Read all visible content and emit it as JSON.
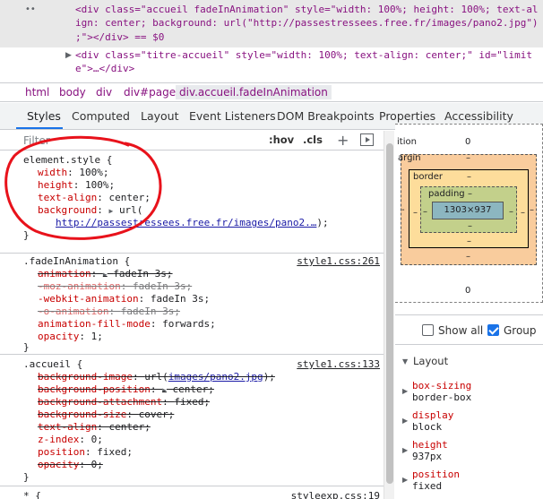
{
  "dom": {
    "dots": "••",
    "line1_a": "<div class=\"accueil fadeInAnimation\" style=\"width: 100%; height: 100%; text-al",
    "line1_b": "ign: center; background: url(\"http://passestressees.free.fr/images/pano2.jpg\")",
    "line1_c": ";\"></div> == $0",
    "line2_a": "<div class=\"titre-accueil\" style=\"width: 100%; text-align: center;\" id=\"limit",
    "line2_b": "e\">…</div>"
  },
  "breadcrumb": [
    "html",
    "body",
    "div",
    "div#page",
    "div.accueil.fadeInAnimation"
  ],
  "tabs": [
    "Styles",
    "Computed",
    "Layout",
    "Event Listeners",
    "DOM Breakpoints",
    "Properties",
    "Accessibility"
  ],
  "filter": {
    "placeholder": "Filter",
    "hov": ":hov",
    "cls": ".cls",
    "plus": "+"
  },
  "rules": {
    "element": {
      "selector": "element.style {",
      "props": [
        {
          "name": "width",
          "value": "100%;"
        },
        {
          "name": "height",
          "value": "100%;"
        },
        {
          "name": "text-align",
          "value": "center;"
        },
        {
          "name": "background",
          "value": "url("
        }
      ],
      "bg_url": "http://passestressees.free.fr/images/pano2.…",
      "bg_close": ");",
      "close": "}"
    },
    "fade": {
      "selector": ".fadeInAnimation {",
      "source": "style1.css:261",
      "props": [
        {
          "name": "animation",
          "value": "fadeIn 3s;"
        },
        {
          "name": "-moz-animation",
          "value": "fadeIn 3s;"
        },
        {
          "name": "-webkit-animation",
          "value": "fadeIn 3s;"
        },
        {
          "name": "-o-animation",
          "value": "fadeIn 3s;"
        },
        {
          "name": "animation-fill-mode",
          "value": "forwards;"
        },
        {
          "name": "opacity",
          "value": "1;"
        }
      ],
      "close": "}"
    },
    "accueil": {
      "selector": ".accueil {",
      "source": "style1.css:133",
      "props": [
        {
          "name": "background-image",
          "value": "url(",
          "link": "images/pano2.jpg",
          "after": ");"
        },
        {
          "name": "background-position",
          "value": "center;"
        },
        {
          "name": "background-attachment",
          "value": "fixed;"
        },
        {
          "name": "background-size",
          "value": "cover;"
        },
        {
          "name": "text-align",
          "value": "center;"
        },
        {
          "name": "z-index",
          "value": "0;"
        },
        {
          "name": "position",
          "value": "fixed;"
        },
        {
          "name": "opacity",
          "value": "0;"
        }
      ],
      "close": "}"
    },
    "star": {
      "selector": "* {",
      "source": "styleexp.css:19"
    }
  },
  "boxmodel": {
    "position_label": "ition",
    "position_val": "0",
    "margin_label": "argin",
    "margin_val": "–",
    "border_label": "border",
    "border_val": "–",
    "padding_label": "padding",
    "padding_val": "–",
    "content": "1303×937",
    "side_val": "–",
    "bottom_dash": "–",
    "bottom_dash2": "–",
    "bottom_zero": "0",
    "left_dash": "-"
  },
  "computed": {
    "show_all": "Show all",
    "group": "Group",
    "layout": "Layout",
    "props": [
      {
        "name": "box-sizing",
        "value": "border-box"
      },
      {
        "name": "display",
        "value": "block"
      },
      {
        "name": "height",
        "value": "937px"
      },
      {
        "name": "position",
        "value": "fixed"
      }
    ]
  },
  "colors": {
    "annotation": "#e8121b",
    "accent": "#1a73e8"
  }
}
